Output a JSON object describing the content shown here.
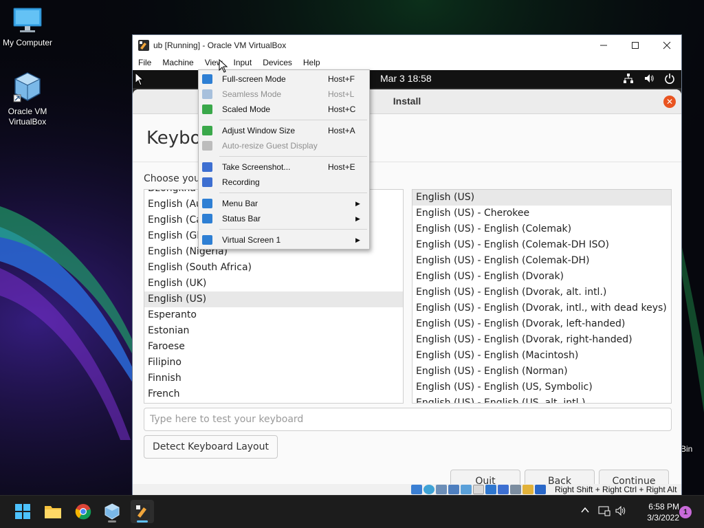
{
  "desktop": {
    "icons": [
      {
        "label": "My Computer"
      },
      {
        "label": "Oracle VM VirtualBox"
      }
    ],
    "partial_bin_label": "Bin"
  },
  "vbox": {
    "window_title": "ub [Running] - Oracle VM VirtualBox",
    "menu": [
      "File",
      "Machine",
      "View",
      "Input",
      "Devices",
      "Help"
    ],
    "status_host_key": "Right Shift + Right Ctrl + Right Alt"
  },
  "view_menu": {
    "items": [
      {
        "label": "Full-screen Mode",
        "shortcut": "Host+F",
        "enabled": true,
        "icon": "fullscreen-icon",
        "color": "#2e7fd4"
      },
      {
        "label": "Seamless Mode",
        "shortcut": "Host+L",
        "enabled": false,
        "icon": "seamless-icon",
        "color": "#a7c0dc"
      },
      {
        "label": "Scaled Mode",
        "shortcut": "Host+C",
        "enabled": true,
        "icon": "scaled-icon",
        "color": "#3aa84a"
      },
      {
        "label": "Adjust Window Size",
        "shortcut": "Host+A",
        "enabled": true,
        "icon": "adjust-window-icon",
        "color": "#3aa84a"
      },
      {
        "label": "Auto-resize Guest Display",
        "shortcut": "",
        "enabled": false,
        "icon": "auto-resize-icon",
        "color": "#bcbcbc"
      },
      {
        "label": "Take Screenshot...",
        "shortcut": "Host+E",
        "enabled": true,
        "icon": "screenshot-icon",
        "color": "#3d6fd1"
      },
      {
        "label": "Recording",
        "shortcut": "",
        "enabled": true,
        "icon": "recording-icon",
        "color": "#3d6fd1"
      },
      {
        "label": "Menu Bar",
        "shortcut": "",
        "enabled": true,
        "icon": "menu-bar-icon",
        "color": "#2e7fd4",
        "submenu": true
      },
      {
        "label": "Status Bar",
        "shortcut": "",
        "enabled": true,
        "icon": "status-bar-icon",
        "color": "#2e7fd4",
        "submenu": true
      },
      {
        "label": "Virtual Screen 1",
        "shortcut": "",
        "enabled": true,
        "icon": "virtual-screen-icon",
        "color": "#2e7fd4",
        "submenu": true
      }
    ]
  },
  "guest": {
    "clock": "Mar 3  18:58",
    "installer_title": "Install",
    "heading": "Keyboa",
    "choose_label": "Choose your",
    "languages": [
      {
        "label": "Dzongkha",
        "selected": false
      },
      {
        "label": "English (Aus",
        "selected": false
      },
      {
        "label": "English (Car",
        "selected": false
      },
      {
        "label": "English (Gha",
        "selected": false
      },
      {
        "label": "English (Nigeria)",
        "selected": false
      },
      {
        "label": "English (South Africa)",
        "selected": false
      },
      {
        "label": "English (UK)",
        "selected": false
      },
      {
        "label": "English (US)",
        "selected": true
      },
      {
        "label": "Esperanto",
        "selected": false
      },
      {
        "label": "Estonian",
        "selected": false
      },
      {
        "label": "Faroese",
        "selected": false
      },
      {
        "label": "Filipino",
        "selected": false
      },
      {
        "label": "Finnish",
        "selected": false
      },
      {
        "label": "French",
        "selected": false
      }
    ],
    "layouts": [
      {
        "label": "English (US)",
        "selected": true
      },
      {
        "label": "English (US) - Cherokee",
        "selected": false
      },
      {
        "label": "English (US) - English (Colemak)",
        "selected": false
      },
      {
        "label": "English (US) - English (Colemak-DH ISO)",
        "selected": false
      },
      {
        "label": "English (US) - English (Colemak-DH)",
        "selected": false
      },
      {
        "label": "English (US) - English (Dvorak)",
        "selected": false
      },
      {
        "label": "English (US) - English (Dvorak, alt. intl.)",
        "selected": false
      },
      {
        "label": "English (US) - English (Dvorak, intl., with dead keys)",
        "selected": false
      },
      {
        "label": "English (US) - English (Dvorak, left-handed)",
        "selected": false
      },
      {
        "label": "English (US) - English (Dvorak, right-handed)",
        "selected": false
      },
      {
        "label": "English (US) - English (Macintosh)",
        "selected": false
      },
      {
        "label": "English (US) - English (Norman)",
        "selected": false
      },
      {
        "label": "English (US) - English (US, Symbolic)",
        "selected": false
      },
      {
        "label": "English (US) - English (US, alt. intl.)",
        "selected": false
      }
    ],
    "test_placeholder": "Type here to test your keyboard",
    "detect_button": "Detect Keyboard Layout",
    "quit_button": "Quit",
    "back_button": "Back",
    "continue_button": "Continue"
  },
  "taskbar": {
    "time": "6:58 PM",
    "date": "3/3/2022",
    "notification_count": "1"
  }
}
